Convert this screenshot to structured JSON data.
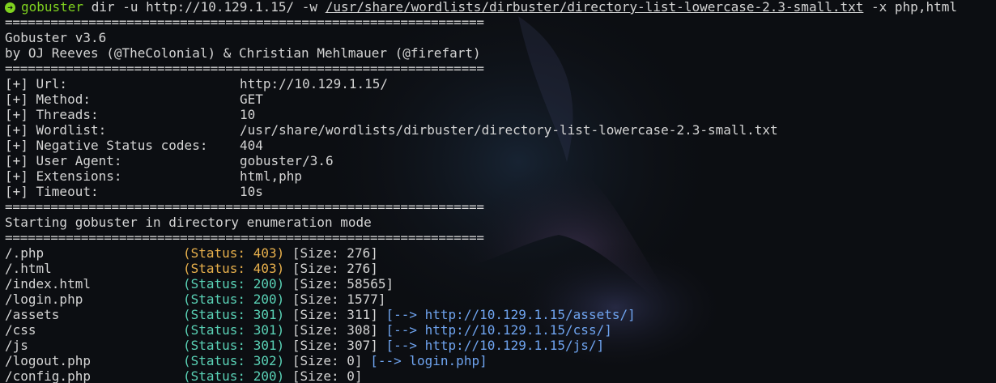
{
  "colors": {
    "background": "#0c0e12",
    "text": "#d4d4d4",
    "prompt_green": "#7fd21f",
    "status_403": "#e8b04c",
    "status_ok": "#5ad2b6",
    "redirect_blue": "#6fa4f0"
  },
  "prompt": {
    "icon": "arrow-right-circle-icon",
    "command": "gobuster",
    "args_before_path": "dir -u http://10.129.1.15/ -w",
    "wordlist_path": "/usr/share/wordlists/dirbuster/directory-list-lowercase-2.3-small.txt",
    "args_after_path": "-x php,html"
  },
  "separator": "===============================================================",
  "banner": {
    "version": "Gobuster v3.6",
    "authors": "by OJ Reeves (@TheColonial) & Christian Mehlmauer (@firefart)"
  },
  "config": [
    {
      "label": "[+] Url:",
      "value": "http://10.129.1.15/"
    },
    {
      "label": "[+] Method:",
      "value": "GET"
    },
    {
      "label": "[+] Threads:",
      "value": "10"
    },
    {
      "label": "[+] Wordlist:",
      "value": "/usr/share/wordlists/dirbuster/directory-list-lowercase-2.3-small.txt"
    },
    {
      "label": "[+] Negative Status codes:",
      "value": "404"
    },
    {
      "label": "[+] User Agent:",
      "value": "gobuster/3.6"
    },
    {
      "label": "[+] Extensions:",
      "value": "html,php"
    },
    {
      "label": "[+] Timeout:",
      "value": "10s"
    }
  ],
  "start_message": "Starting gobuster in directory enumeration mode",
  "results": [
    {
      "path": "/.php",
      "status": "(Status: 403)",
      "size": "[Size: 276]",
      "redirect": ""
    },
    {
      "path": "/.html",
      "status": "(Status: 403)",
      "size": "[Size: 276]",
      "redirect": ""
    },
    {
      "path": "/index.html",
      "status": "(Status: 200)",
      "size": "[Size: 58565]",
      "redirect": ""
    },
    {
      "path": "/login.php",
      "status": "(Status: 200)",
      "size": "[Size: 1577]",
      "redirect": ""
    },
    {
      "path": "/assets",
      "status": "(Status: 301)",
      "size": "[Size: 311]",
      "redirect": "[--> http://10.129.1.15/assets/]"
    },
    {
      "path": "/css",
      "status": "(Status: 301)",
      "size": "[Size: 308]",
      "redirect": "[--> http://10.129.1.15/css/]"
    },
    {
      "path": "/js",
      "status": "(Status: 301)",
      "size": "[Size: 307]",
      "redirect": "[--> http://10.129.1.15/js/]"
    },
    {
      "path": "/logout.php",
      "status": "(Status: 302)",
      "size": "[Size: 0]",
      "redirect": "[--> login.php]"
    },
    {
      "path": "/config.php",
      "status": "(Status: 200)",
      "size": "[Size: 0]",
      "redirect": ""
    }
  ]
}
